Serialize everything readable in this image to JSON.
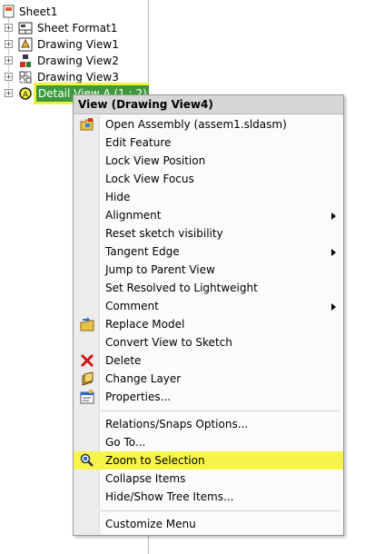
{
  "tree": {
    "items": [
      {
        "label": "Sheet1"
      },
      {
        "label": "Sheet Format1"
      },
      {
        "label": "Drawing View1"
      },
      {
        "label": "Drawing View2"
      },
      {
        "label": "Drawing View3"
      },
      {
        "label": "Detail View A (1 : 2)"
      }
    ]
  },
  "menu": {
    "header": "View (Drawing View4)",
    "items": [
      {
        "label": "Open Assembly (assem1.sldasm)",
        "icon": "open-assembly-icon"
      },
      {
        "label": "Edit Feature"
      },
      {
        "label": "Lock View Position"
      },
      {
        "label": "Lock View Focus"
      },
      {
        "label": "Hide"
      },
      {
        "label": "Alignment",
        "submenu": true
      },
      {
        "label": "Reset sketch visibility"
      },
      {
        "label": "Tangent Edge",
        "submenu": true
      },
      {
        "label": "Jump to Parent View"
      },
      {
        "label": "Set Resolved to Lightweight"
      },
      {
        "label": "Comment",
        "submenu": true
      },
      {
        "label": "Replace Model",
        "icon": "replace-model-icon"
      },
      {
        "label": "Convert View to Sketch"
      },
      {
        "label": "Delete",
        "icon": "delete-icon"
      },
      {
        "label": "Change Layer",
        "icon": "change-layer-icon"
      },
      {
        "label": "Properties...",
        "icon": "properties-icon"
      },
      {
        "label": "Relations/Snaps Options..."
      },
      {
        "label": "Go To..."
      },
      {
        "label": "Zoom to Selection",
        "icon": "zoom-to-selection-icon",
        "highlighted": true
      },
      {
        "label": "Collapse Items"
      },
      {
        "label": "Hide/Show Tree Items..."
      },
      {
        "label": "Customize Menu"
      }
    ]
  },
  "colors": {
    "selection": "#3c9a3c",
    "highlight": "#f7f54a",
    "delete": "#d01818"
  }
}
